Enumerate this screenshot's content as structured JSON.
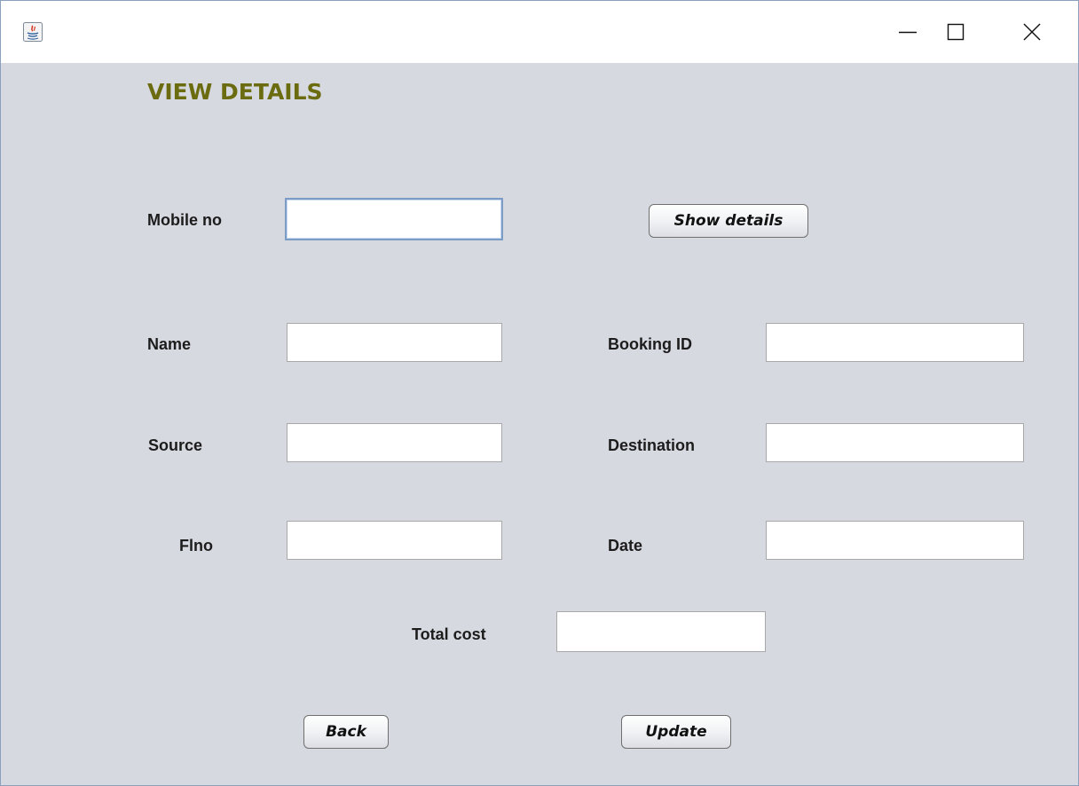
{
  "window": {
    "title": "",
    "icon": "java-icon",
    "controls": {
      "minimize_icon": "minimize-icon",
      "maximize_icon": "maximize-icon",
      "close_icon": "close-icon"
    }
  },
  "form": {
    "heading": "VIEW DETAILS",
    "mobile": {
      "label": "Mobile no",
      "value": ""
    },
    "show_details_button": "Show details",
    "name": {
      "label": "Name",
      "value": ""
    },
    "booking_id": {
      "label": "Booking ID",
      "value": ""
    },
    "source": {
      "label": "Source",
      "value": ""
    },
    "destination": {
      "label": "Destination",
      "value": ""
    },
    "flno": {
      "label": "Flno",
      "value": ""
    },
    "date": {
      "label": "Date",
      "value": ""
    },
    "total_cost": {
      "label": "Total cost",
      "value": ""
    },
    "back_button": "Back",
    "update_button": "Update"
  },
  "colors": {
    "background": "#d7d9e1",
    "heading": "#6b6c0f",
    "focus_border": "#7a9cc7"
  }
}
